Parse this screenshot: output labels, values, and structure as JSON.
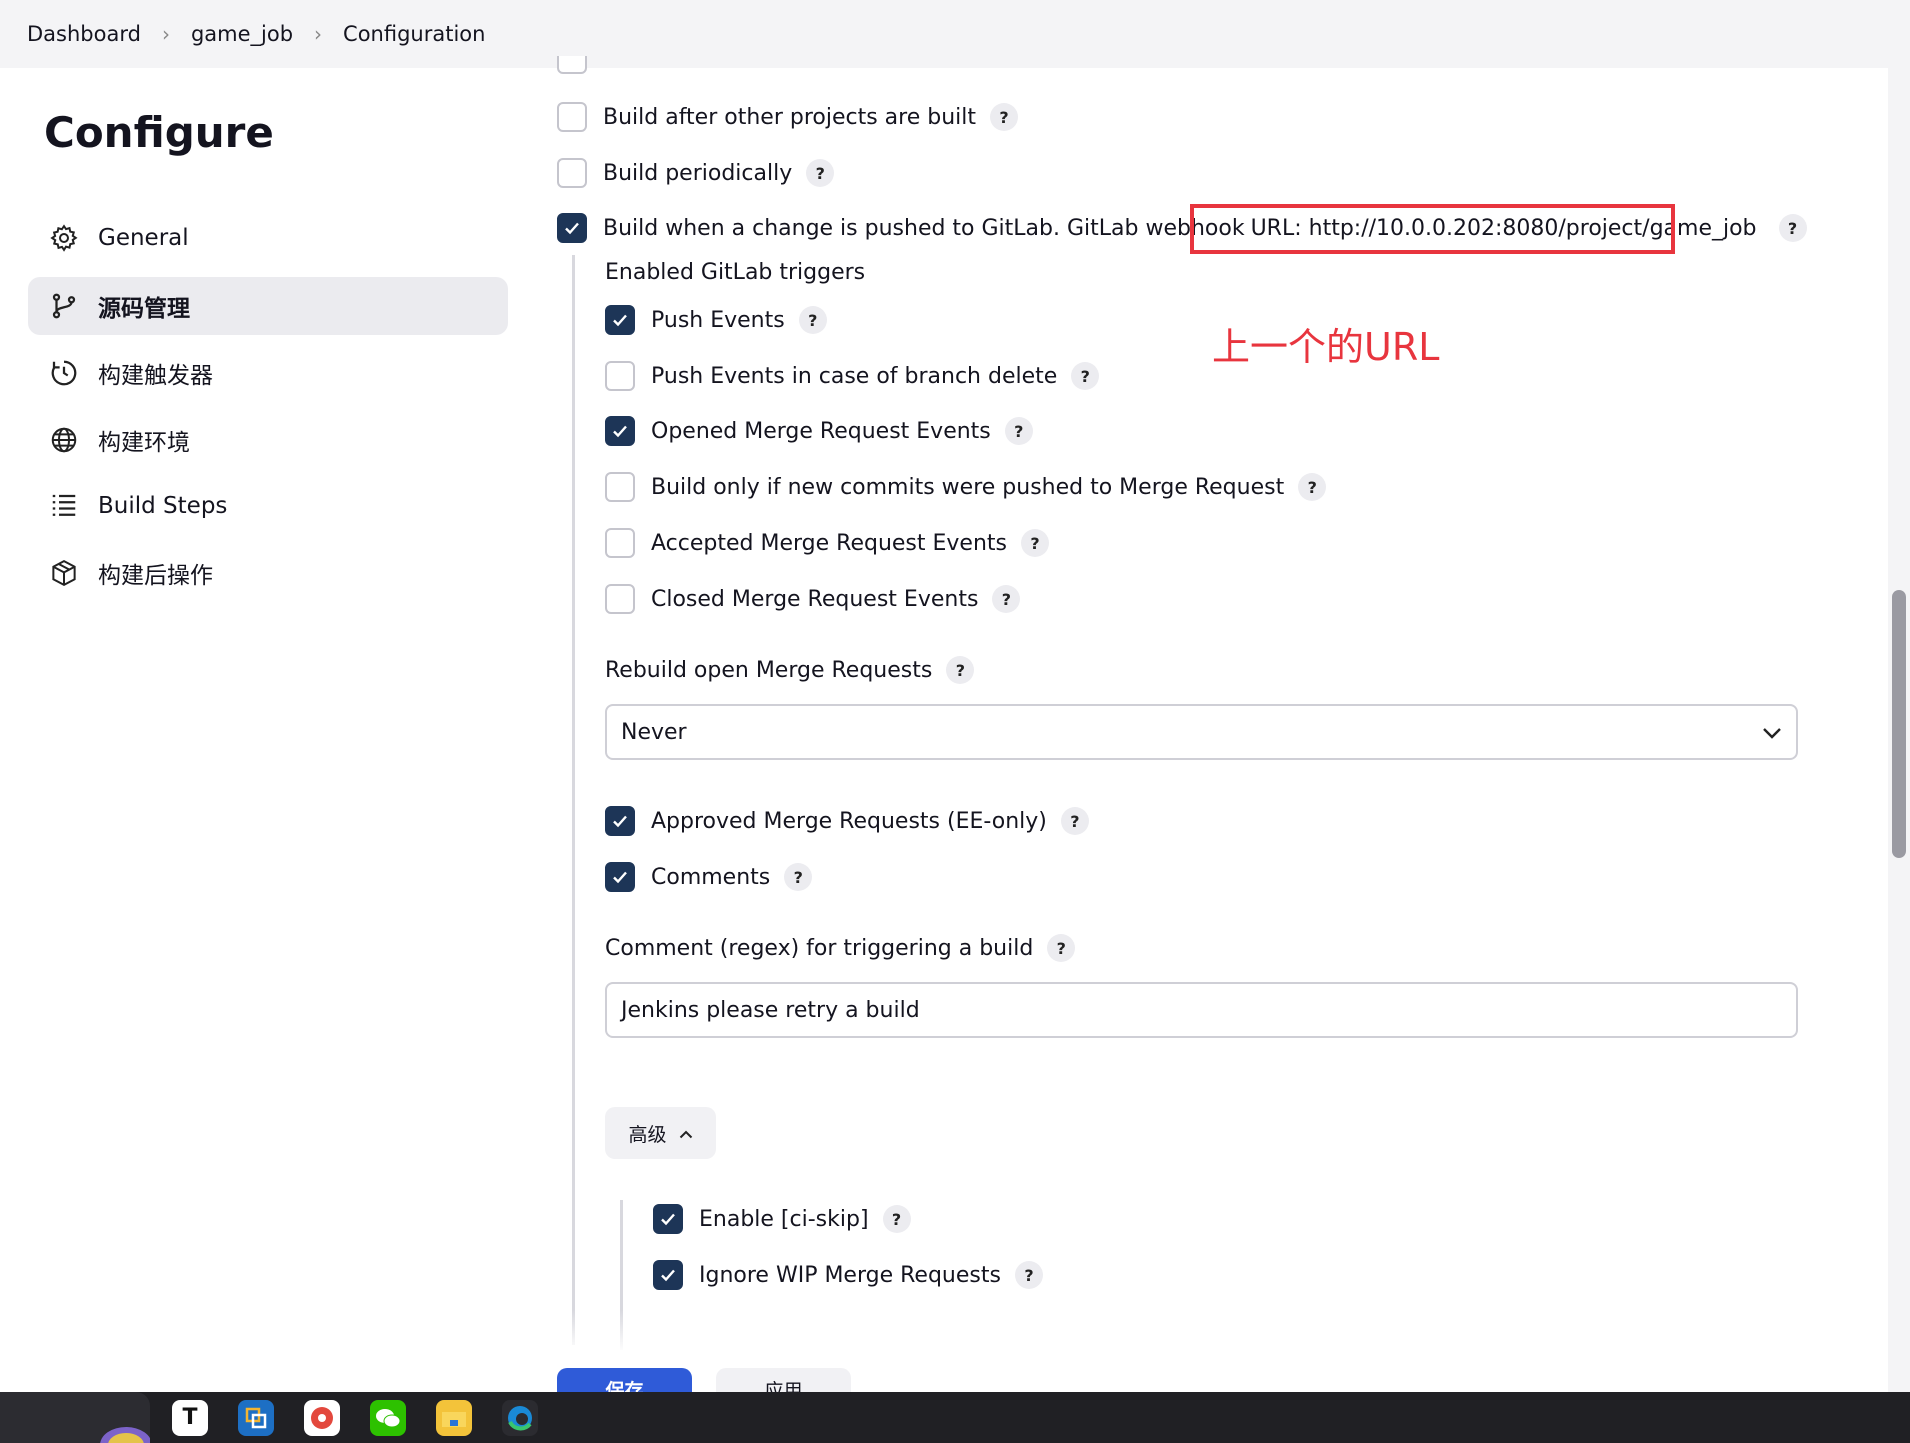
{
  "breadcrumb": {
    "items": [
      "Dashboard",
      "game_job",
      "Configuration"
    ]
  },
  "sidebar": {
    "title": "Configure",
    "items": [
      {
        "label": "General",
        "icon": "gear-icon"
      },
      {
        "label": "源码管理",
        "icon": "branch-icon",
        "active": true
      },
      {
        "label": "构建触发器",
        "icon": "clock-icon"
      },
      {
        "label": "构建环境",
        "icon": "globe-icon"
      },
      {
        "label": "Build Steps",
        "icon": "list-icon"
      },
      {
        "label": "构建后操作",
        "icon": "package-icon"
      }
    ]
  },
  "triggers": {
    "build_after_other": "Build after other projects are built",
    "build_periodically": "Build periodically",
    "gitlab_trigger": "Build when a change is pushed to GitLab. GitLab webhook",
    "webhook_url": "URL: http://10.0.0.202:8080/project/game_job",
    "enabled_gitlab_triggers": "Enabled GitLab triggers",
    "push_events": "Push Events",
    "push_events_branch_delete": "Push Events in case of branch delete",
    "opened_mr_events": "Opened Merge Request Events",
    "build_only_new_commits": "Build only if new commits were pushed to Merge Request",
    "accepted_mr_events": "Accepted Merge Request Events",
    "closed_mr_events": "Closed Merge Request Events",
    "rebuild_open_mr_label": "Rebuild open Merge Requests",
    "rebuild_open_mr_value": "Never",
    "approved_mr": "Approved Merge Requests (EE-only)",
    "comments": "Comments",
    "comment_regex_label": "Comment (regex) for triggering a build",
    "comment_regex_value": "Jenkins please retry a build",
    "advanced_label": "高级",
    "enable_ci_skip": "Enable [ci-skip]",
    "ignore_wip": "Ignore WIP Merge Requests"
  },
  "annotation": {
    "text": "上一个的URL",
    "color": "#e8353e"
  },
  "footer": {
    "save_label": "保存",
    "apply_label": "应用"
  },
  "help_glyph": "?",
  "colors": {
    "checkbox_checked": "#1d3557",
    "accent": "#2f5bd8"
  }
}
